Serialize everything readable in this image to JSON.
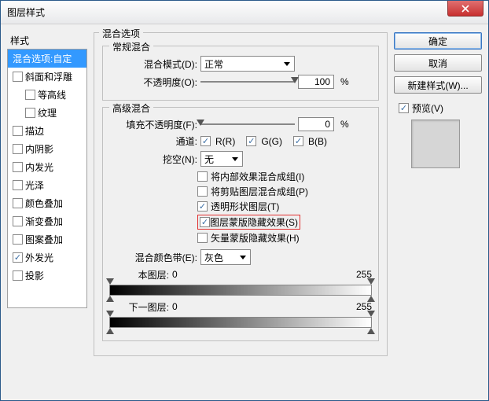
{
  "window": {
    "title": "图层样式"
  },
  "sidebar": {
    "title": "样式",
    "items": [
      {
        "label": "混合选项:自定",
        "checked": null,
        "selected": true,
        "indent": false
      },
      {
        "label": "斜面和浮雕",
        "checked": false,
        "indent": false
      },
      {
        "label": "等高线",
        "checked": false,
        "indent": true
      },
      {
        "label": "纹理",
        "checked": false,
        "indent": true
      },
      {
        "label": "描边",
        "checked": false,
        "indent": false
      },
      {
        "label": "内阴影",
        "checked": false,
        "indent": false
      },
      {
        "label": "内发光",
        "checked": false,
        "indent": false
      },
      {
        "label": "光泽",
        "checked": false,
        "indent": false
      },
      {
        "label": "颜色叠加",
        "checked": false,
        "indent": false
      },
      {
        "label": "渐变叠加",
        "checked": false,
        "indent": false
      },
      {
        "label": "图案叠加",
        "checked": false,
        "indent": false
      },
      {
        "label": "外发光",
        "checked": true,
        "indent": false
      },
      {
        "label": "投影",
        "checked": false,
        "indent": false
      }
    ]
  },
  "main": {
    "group_title": "混合选项",
    "general": {
      "title": "常规混合",
      "blend_mode_label": "混合模式(D):",
      "blend_mode_value": "正常",
      "opacity_label": "不透明度(O):",
      "opacity_value": "100",
      "pct": "%"
    },
    "advanced": {
      "title": "高级混合",
      "fill_label": "填充不透明度(F):",
      "fill_value": "0",
      "pct": "%",
      "channels_label": "通道:",
      "ch_r": "R(R)",
      "ch_g": "G(G)",
      "ch_b": "B(B)",
      "knockout_label": "挖空(N):",
      "knockout_value": "无",
      "checks": [
        {
          "label": "将内部效果混合成组(I)",
          "checked": false
        },
        {
          "label": "将剪贴图层混合成组(P)",
          "checked": false
        },
        {
          "label": "透明形状图层(T)",
          "checked": true
        },
        {
          "label": "图层蒙版隐藏效果(S)",
          "checked": true,
          "highlight": true
        },
        {
          "label": "矢量蒙版隐藏效果(H)",
          "checked": false
        }
      ]
    },
    "blendif": {
      "label": "混合颜色带(E):",
      "value": "灰色",
      "this_layer": "本图层:",
      "next_layer": "下一图层:",
      "min": "0",
      "max": "255"
    }
  },
  "buttons": {
    "ok": "确定",
    "cancel": "取消",
    "newstyle": "新建样式(W)...",
    "preview": "预览(V)"
  }
}
